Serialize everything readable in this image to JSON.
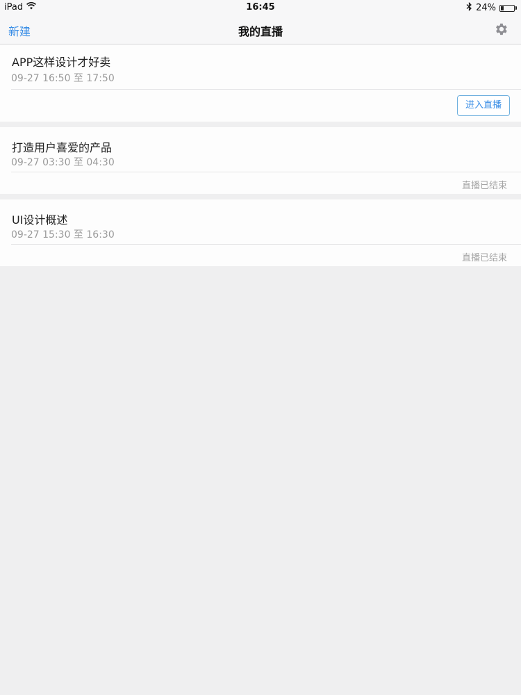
{
  "status_bar": {
    "device": "iPad",
    "time": "16:45",
    "battery_percent": "24%",
    "battery_level": 0.24,
    "wifi_icon": "wifi-icon",
    "bluetooth_icon": "bluetooth-icon"
  },
  "nav": {
    "new_label": "新建",
    "title": "我的直播",
    "settings_icon": "gear-icon"
  },
  "streams": [
    {
      "title": "APP这样设计才好卖",
      "time": "09-27 16:50 至 17:50",
      "action_label": "进入直播"
    },
    {
      "title": "打造用户喜爱的产品",
      "time": "09-27 03:30 至 04:30",
      "status_label": "直播已结束"
    },
    {
      "title": "UI设计概述",
      "time": "09-27 15:30 至 16:30",
      "status_label": "直播已结束"
    }
  ],
  "colors": {
    "accent": "#3a8ee6",
    "background": "#efeff0"
  }
}
